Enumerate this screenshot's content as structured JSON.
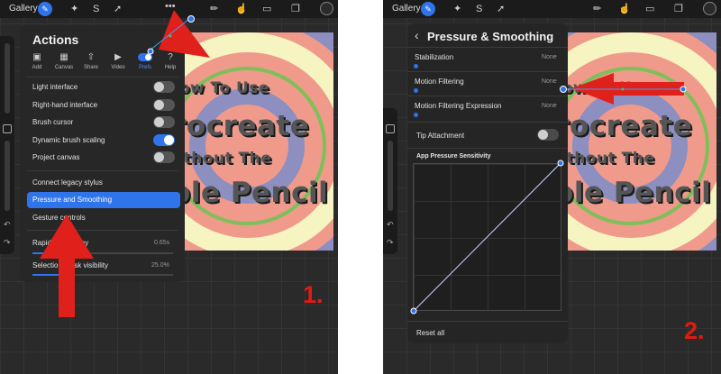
{
  "colors": {
    "accent": "#2f74ea",
    "arrow": "#e0201a",
    "canvas_bg": "#f09a8c",
    "swirl_purple": "#8c8fc0",
    "swirl_yellow": "#f6f5c2",
    "swirl_green": "#7fbf5a"
  },
  "topbar": {
    "gallery": "Gallery"
  },
  "canvas_text": {
    "line1": "How To Use",
    "line2": "Procreate",
    "line3": "Without The",
    "line4": "Apple Pencil"
  },
  "actions": {
    "title": "Actions",
    "tabs": [
      {
        "label": "Add",
        "icon": "add-icon"
      },
      {
        "label": "Canvas",
        "icon": "canvas-icon"
      },
      {
        "label": "Share",
        "icon": "share-icon"
      },
      {
        "label": "Video",
        "icon": "video-icon"
      },
      {
        "label": "Prefs",
        "icon": "toggle-icon"
      },
      {
        "label": "Help",
        "icon": "help-icon"
      }
    ],
    "toggles": [
      {
        "label": "Light interface",
        "on": false
      },
      {
        "label": "Right-hand interface",
        "on": false
      },
      {
        "label": "Brush cursor",
        "on": false
      },
      {
        "label": "Dynamic brush scaling",
        "on": true
      },
      {
        "label": "Project canvas",
        "on": false
      }
    ],
    "links": {
      "legacy": "Connect legacy stylus",
      "pressure": "Pressure and Smoothing",
      "gesture": "Gesture controls"
    },
    "sliders": [
      {
        "label": "Rapid undo delay",
        "value": "0.65s",
        "fraction": 0.4
      },
      {
        "label": "Selection mask visibility",
        "value": "25.0%",
        "fraction": 0.25
      }
    ]
  },
  "pressure": {
    "title": "Pressure & Smoothing",
    "rows": [
      {
        "label": "Stabilization",
        "value": "None"
      },
      {
        "label": "Motion Filtering",
        "value": "None"
      },
      {
        "label": "Motion Filtering Expression",
        "value": "None"
      }
    ],
    "tip": "Tip Attachment",
    "curve_title": "App Pressure Sensitivity",
    "reset": "Reset all"
  },
  "steps": {
    "one": "1.",
    "two": "2."
  }
}
